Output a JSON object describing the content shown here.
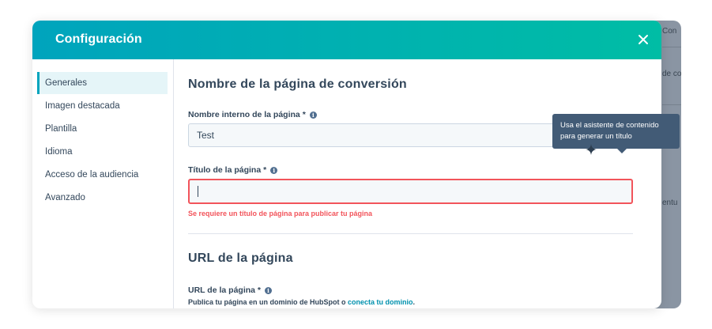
{
  "modal": {
    "title": "Configuración"
  },
  "sidebar": {
    "items": [
      {
        "label": "Generales",
        "active": true
      },
      {
        "label": "Imagen destacada"
      },
      {
        "label": "Plantilla"
      },
      {
        "label": "Idioma"
      },
      {
        "label": "Acceso de la audiencia"
      },
      {
        "label": "Avanzado"
      }
    ]
  },
  "section1": {
    "heading": "Nombre de la página de conversión",
    "internal_name_label": "Nombre interno de la página *",
    "internal_name_value": "Test",
    "page_title_label": "Título de la página *",
    "page_title_value": "",
    "page_title_error": "Se requiere un título de página para publicar tu página"
  },
  "section2": {
    "heading": "URL de la página",
    "url_label": "URL de la página *",
    "help_prefix": "Publica tu página en un dominio de HubSpot o ",
    "help_link": "conecta tu dominio",
    "help_suffix": "."
  },
  "tooltip": {
    "line1": "Usa el asistente de contenido",
    "line2": "para generar un título"
  },
  "background": {
    "fragments": [
      "Con",
      "de co",
      "entu"
    ]
  },
  "colors": {
    "header_start": "#00a4bd",
    "header_end": "#00bda5",
    "error": "#f2545b",
    "link": "#0091ae",
    "tooltip_bg": "#425b76"
  }
}
